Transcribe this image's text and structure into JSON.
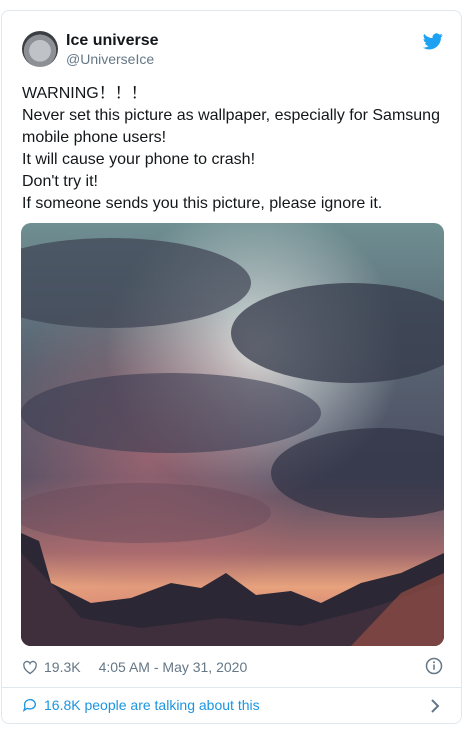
{
  "tweet": {
    "author_name": "Ice universe",
    "author_handle": "@UniverseIce",
    "text": "WARNING！！！\nNever set this picture as wallpaper, especially for Samsung mobile phone users!\nIt will cause your phone to crash!\nDon't try it!\nIf someone sends you this picture, please ignore it.",
    "likes": "19.3K",
    "timestamp": "4:05 AM - May 31, 2020",
    "talking_text": "16.8K people are talking about this"
  },
  "icons": {
    "brand": "twitter-bird-icon",
    "like": "heart-icon",
    "info": "info-icon",
    "comments": "speech-bubble-icon",
    "chevron": "chevron-right-icon"
  },
  "colors": {
    "accent": "#1da1f2",
    "link": "#1b95e0",
    "secondary_text": "#657786",
    "border": "#e1e8ed"
  }
}
